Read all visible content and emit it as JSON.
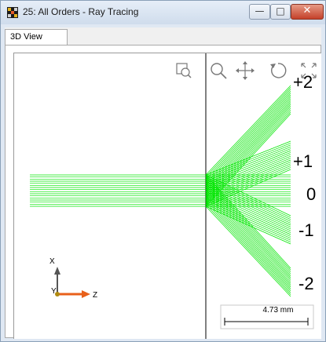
{
  "window": {
    "title": "25: All Orders - Ray Tracing",
    "controls": {
      "minimize": "—",
      "maximize": "□",
      "close": "✕"
    }
  },
  "tabs": [
    {
      "label": "3D View",
      "active": true
    }
  ],
  "toolbar": {
    "icons": [
      "zoom-window-icon",
      "zoom-icon",
      "pan-icon",
      "rotate-icon",
      "fit-view-icon"
    ]
  },
  "orders": {
    "labels": [
      "+2",
      "+1",
      "0",
      "-1",
      "-2"
    ]
  },
  "axes": {
    "x_label": "X",
    "y_label": "Y",
    "z_label": "Z"
  },
  "scale_bar": {
    "label": "4.73 mm"
  },
  "colors": {
    "rays": "#00e600",
    "axis_z": "#e8601a",
    "axis_x": "#555555"
  }
}
